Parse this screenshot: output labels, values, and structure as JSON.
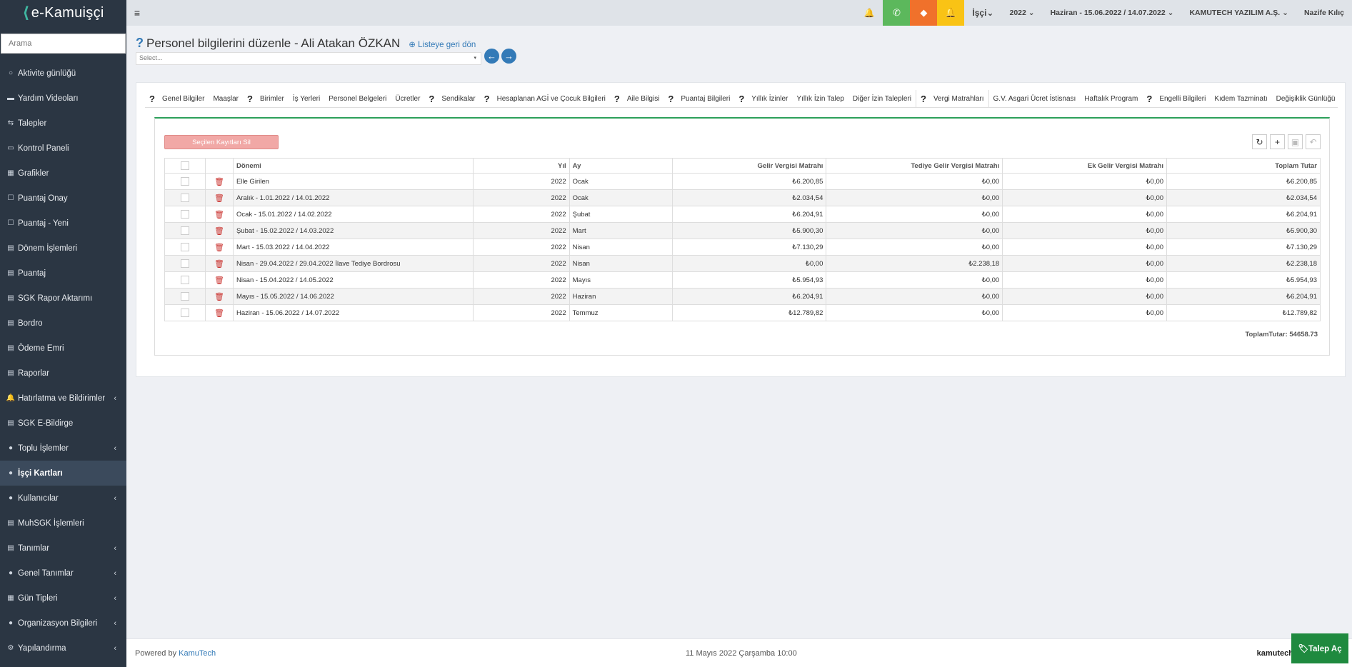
{
  "app": {
    "logo_mark": "⟨",
    "logo_text": "e-Kamuişçi"
  },
  "search": {
    "placeholder": "Arama"
  },
  "sidebar": {
    "items": [
      {
        "label": "Aktivite günlüğü",
        "icon": "○",
        "chevron": ""
      },
      {
        "label": "Yardım Videoları",
        "icon": "▬",
        "chevron": ""
      },
      {
        "label": "Talepler",
        "icon": "⇆",
        "chevron": ""
      },
      {
        "label": "Kontrol Paneli",
        "icon": "▭",
        "chevron": ""
      },
      {
        "label": "Grafikler",
        "icon": "▦",
        "chevron": ""
      },
      {
        "label": "Puantaj Onay",
        "icon": "☐",
        "chevron": ""
      },
      {
        "label": "Puantaj - Yeni",
        "icon": "☐",
        "chevron": ""
      },
      {
        "label": "Dönem İşlemleri",
        "icon": "▤",
        "chevron": ""
      },
      {
        "label": "Puantaj",
        "icon": "▤",
        "chevron": ""
      },
      {
        "label": "SGK Rapor Aktarımı",
        "icon": "▤",
        "chevron": ""
      },
      {
        "label": "Bordro",
        "icon": "▤",
        "chevron": ""
      },
      {
        "label": "Ödeme Emri",
        "icon": "▤",
        "chevron": ""
      },
      {
        "label": "Raporlar",
        "icon": "▤",
        "chevron": ""
      },
      {
        "label": "Hatırlatma ve Bildirimler",
        "icon": "🔔",
        "chevron": "‹"
      },
      {
        "label": "SGK E-Bildirge",
        "icon": "▤",
        "chevron": ""
      },
      {
        "label": "Toplu İşlemler",
        "icon": "●",
        "chevron": "‹"
      },
      {
        "label": "İşçi Kartları",
        "icon": "●",
        "chevron": ""
      },
      {
        "label": "Kullanıcılar",
        "icon": "●",
        "chevron": "‹"
      },
      {
        "label": "MuhSGK İşlemleri",
        "icon": "▤",
        "chevron": ""
      },
      {
        "label": "Tanımlar",
        "icon": "▤",
        "chevron": "‹"
      },
      {
        "label": "Genel Tanımlar",
        "icon": "●",
        "chevron": "‹"
      },
      {
        "label": "Gün Tipleri",
        "icon": "▦",
        "chevron": "‹"
      },
      {
        "label": "Organizasyon Bilgileri",
        "icon": "●",
        "chevron": "‹"
      },
      {
        "label": "Yapılandırma",
        "icon": "⚙",
        "chevron": "‹"
      }
    ]
  },
  "topbar": {
    "menu_icon": "≡",
    "bell_icon": "🔔",
    "phone_icon": "✆",
    "ticket_icon": "◆",
    "alert_icon": "🔔",
    "role": "İşçi",
    "year": "2022",
    "period": "Haziran - 15.06.2022 / 14.07.2022",
    "company": "KAMUTECH YAZILIM A.Ş.",
    "user": "Nazife Kılıç",
    "dd_caret": "⌄"
  },
  "page": {
    "q": "?",
    "title": "Personel bilgilerini düzenle - Ali Atakan ÖZKAN",
    "back_link": "⊕ Listeye geri dön",
    "select_placeholder": "Select...",
    "select_caret": "▾",
    "prev_icon": "←",
    "next_icon": "→"
  },
  "tabs": [
    {
      "q": "?",
      "label": "Genel Bilgiler"
    },
    {
      "q": "",
      "label": "Maaşlar"
    },
    {
      "q": "?",
      "label": "Birimler"
    },
    {
      "q": "",
      "label": "İş Yerleri"
    },
    {
      "q": "",
      "label": "Personel Belgeleri"
    },
    {
      "q": "",
      "label": "Ücretler"
    },
    {
      "q": "?",
      "label": "Sendikalar"
    },
    {
      "q": "?",
      "label": "Hesaplanan AGİ ve Çocuk Bilgileri"
    },
    {
      "q": "?",
      "label": "Aile Bilgisi"
    },
    {
      "q": "?",
      "label": "Puantaj Bilgileri"
    },
    {
      "q": "?",
      "label": "Yıllık İzinler"
    },
    {
      "q": "",
      "label": "Yıllık İzin Talep"
    },
    {
      "q": "",
      "label": "Diğer İzin Talepleri"
    },
    {
      "q": "?",
      "label": "Vergi Matrahları",
      "active": true
    },
    {
      "q": "",
      "label": "G.V. Asgari Ücret İstisnası"
    },
    {
      "q": "",
      "label": "Haftalık Program"
    },
    {
      "q": "?",
      "label": "Engelli Bilgileri"
    },
    {
      "q": "",
      "label": "Kıdem Tazminatı"
    },
    {
      "q": "",
      "label": "Değişiklik Günlüğü"
    }
  ],
  "toolbar": {
    "delete_selected": "Seçilen Kayıtları Sil",
    "refresh_icon": "↻",
    "add_icon": "+",
    "save_icon": "▣",
    "undo_icon": "↶"
  },
  "table": {
    "headers": [
      "Dönemi",
      "Yıl",
      "Ay",
      "Gelir Vergisi Matrahı",
      "Tediye Gelir Vergisi Matrahı",
      "Ek Gelir Vergisi Matrahı",
      "Toplam Tutar"
    ],
    "trash_icon": "🗑",
    "rows": [
      [
        "Elle Girilen",
        "2022",
        "Ocak",
        "₺6.200,85",
        "₺0,00",
        "₺0,00",
        "₺6.200,85"
      ],
      [
        "Aralık - 1.01.2022 / 14.01.2022",
        "2022",
        "Ocak",
        "₺2.034,54",
        "₺0,00",
        "₺0,00",
        "₺2.034,54"
      ],
      [
        "Ocak - 15.01.2022 / 14.02.2022",
        "2022",
        "Şubat",
        "₺6.204,91",
        "₺0,00",
        "₺0,00",
        "₺6.204,91"
      ],
      [
        "Şubat - 15.02.2022 / 14.03.2022",
        "2022",
        "Mart",
        "₺5.900,30",
        "₺0,00",
        "₺0,00",
        "₺5.900,30"
      ],
      [
        "Mart - 15.03.2022 / 14.04.2022",
        "2022",
        "Nisan",
        "₺7.130,29",
        "₺0,00",
        "₺0,00",
        "₺7.130,29"
      ],
      [
        "Nisan - 29.04.2022 / 29.04.2022 İlave Tediye Bordrosu",
        "2022",
        "Nisan",
        "₺0,00",
        "₺2.238,18",
        "₺0,00",
        "₺2.238,18"
      ],
      [
        "Nisan - 15.04.2022 / 14.05.2022",
        "2022",
        "Mayıs",
        "₺5.954,93",
        "₺0,00",
        "₺0,00",
        "₺5.954,93"
      ],
      [
        "Mayıs - 15.05.2022 / 14.06.2022",
        "2022",
        "Haziran",
        "₺6.204,91",
        "₺0,00",
        "₺0,00",
        "₺6.204,91"
      ],
      [
        "Haziran - 15.06.2022 / 14.07.2022",
        "2022",
        "Temmuz",
        "₺12.789,82",
        "₺0,00",
        "₺0,00",
        "₺12.789,82"
      ]
    ],
    "total": "ToplamTutar: 54658.73"
  },
  "footer": {
    "powered_by": "Powered by",
    "powered_brand": "KamuTech",
    "datetime": "11 Mayıs 2022 Çarşamba 10:00",
    "brand": "kamutech",
    "talep_button": "🏷Talep Aç"
  }
}
